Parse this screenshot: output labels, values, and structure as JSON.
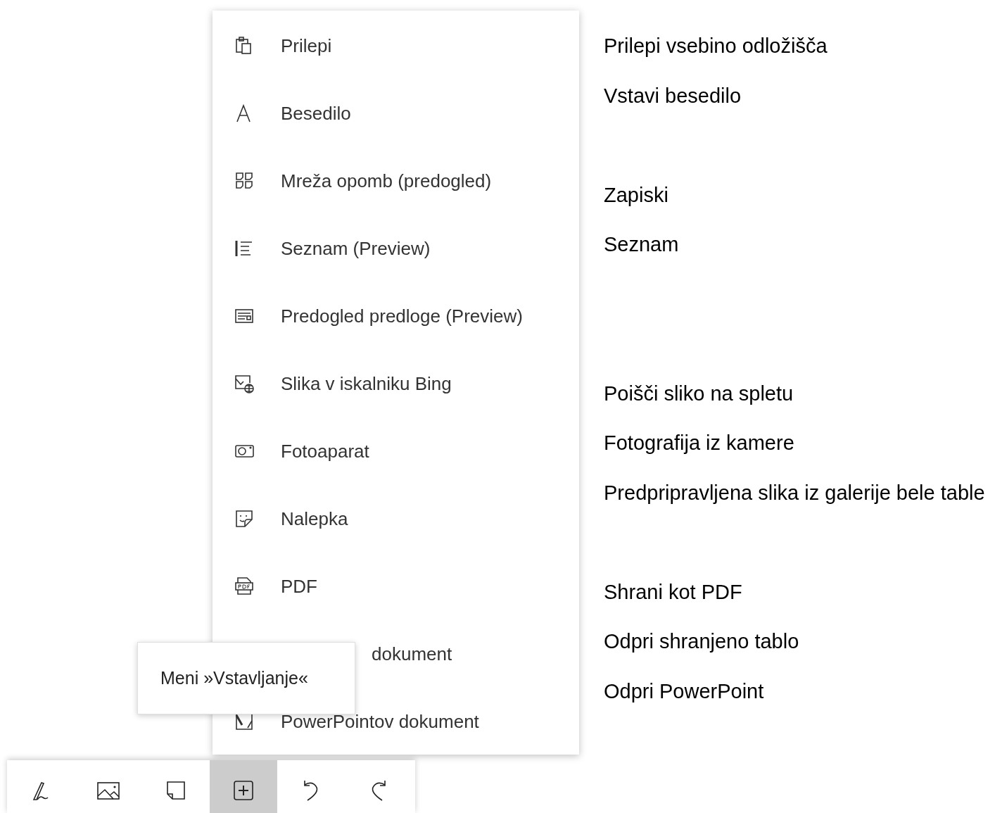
{
  "insert_menu": {
    "items": [
      {
        "kind": "paste",
        "label": "Prilepi"
      },
      {
        "kind": "text",
        "label": "Besedilo"
      },
      {
        "kind": "notes-grid",
        "label": "Mreža opomb (predogled)"
      },
      {
        "kind": "list",
        "label": "Seznam (Preview)"
      },
      {
        "kind": "template",
        "label": "Predogled predloge (Preview)"
      },
      {
        "kind": "bing-image",
        "label": "Slika v iskalniku Bing"
      },
      {
        "kind": "camera",
        "label": "Fotoaparat"
      },
      {
        "kind": "sticker",
        "label": "Nalepka"
      },
      {
        "kind": "pdf",
        "label": "PDF"
      },
      {
        "kind": "covered",
        "label": "dokument"
      },
      {
        "kind": "powerpoint",
        "label": "PowerPointov dokument"
      }
    ]
  },
  "tooltip": {
    "text": "Meni »Vstavljanje«"
  },
  "toolbar": {
    "buttons": [
      {
        "kind": "pen",
        "selected": false
      },
      {
        "kind": "image",
        "selected": false
      },
      {
        "kind": "note",
        "selected": false
      },
      {
        "kind": "insert",
        "selected": true
      },
      {
        "kind": "undo",
        "selected": false
      },
      {
        "kind": "redo",
        "selected": false
      }
    ]
  },
  "annotations": [
    "Prilepi vsebino odložišča",
    "Vstavi besedilo",
    "Zapiski",
    "Seznam",
    "Poišči sliko na spletu",
    "Fotografija iz kamere",
    "Predpripravljena slika iz galerije bele table",
    "Shrani kot PDF",
    "Odpri shranjeno tablo",
    "Odpri PowerPoint"
  ]
}
